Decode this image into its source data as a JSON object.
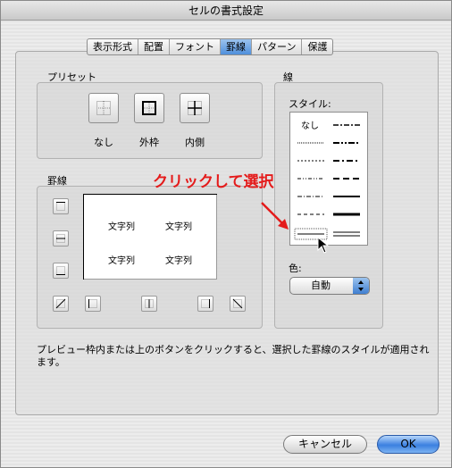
{
  "window": {
    "title": "セルの書式設定"
  },
  "tabs": [
    {
      "label": "表示形式",
      "active": false
    },
    {
      "label": "配置",
      "active": false
    },
    {
      "label": "フォント",
      "active": false
    },
    {
      "label": "罫線",
      "active": true
    },
    {
      "label": "パターン",
      "active": false
    },
    {
      "label": "保護",
      "active": false
    }
  ],
  "presets": {
    "label": "プリセット",
    "buttons": [
      {
        "label": "なし",
        "icon": "border-none-icon"
      },
      {
        "label": "外枠",
        "icon": "border-outline-icon"
      },
      {
        "label": "内側",
        "icon": "border-inside-icon"
      }
    ]
  },
  "border": {
    "label": "罫線",
    "preview_text": [
      "文字列",
      "文字列",
      "文字列",
      "文字列"
    ]
  },
  "line": {
    "label": "線",
    "style_label": "スタイル:",
    "none_label": "なし",
    "color_label": "色:",
    "color_value": "自動"
  },
  "callout": {
    "text": "クリックして選択",
    "color": "#e41b1b"
  },
  "description": "プレビュー枠内または上のボタンをクリックすると、選択した罫線のスタイルが適用されます。",
  "buttons": {
    "cancel": "キャンセル",
    "ok": "OK"
  },
  "colors": {
    "accent": "#4f8fdc",
    "callout": "#e41b1b"
  }
}
